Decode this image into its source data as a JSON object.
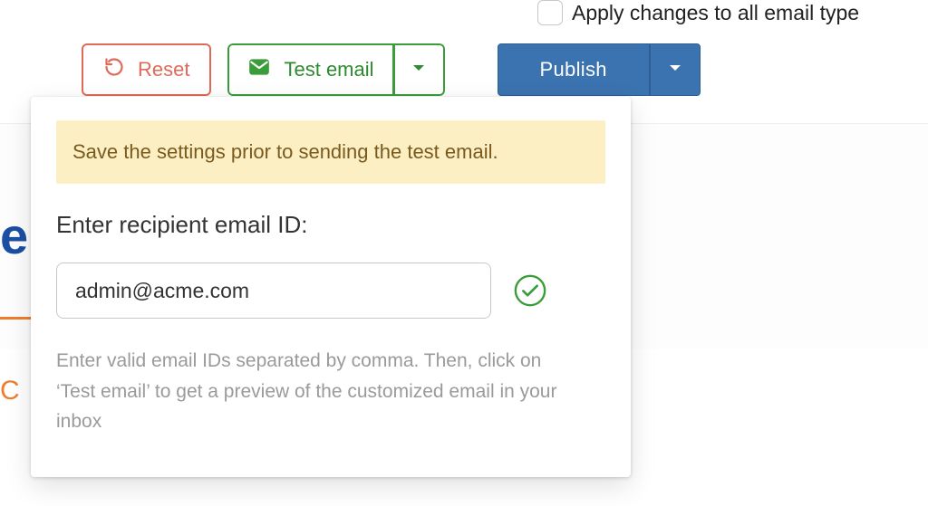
{
  "apply_all": {
    "label": "Apply changes to all email type",
    "checked": false
  },
  "toolbar": {
    "reset_label": "Reset",
    "test_email_label": "Test email",
    "publish_label": "Publish"
  },
  "popover": {
    "warning": "Save the settings prior to sending the test email.",
    "prompt": "Enter recipient email ID:",
    "email_value": "admin@acme.com",
    "email_placeholder": "",
    "hint": "Enter valid email IDs separated by comma. Then, click on ‘Test email’ to get a preview of the customized email in your inbox"
  },
  "bg": {
    "blue_fragment": "el",
    "orange_fragment": "C"
  },
  "colors": {
    "reset": "#e06a5a",
    "test": "#3a9d3a",
    "publish": "#3b72b0",
    "warn_bg": "#fcefc4",
    "warn_fg": "#7a5a1d"
  }
}
